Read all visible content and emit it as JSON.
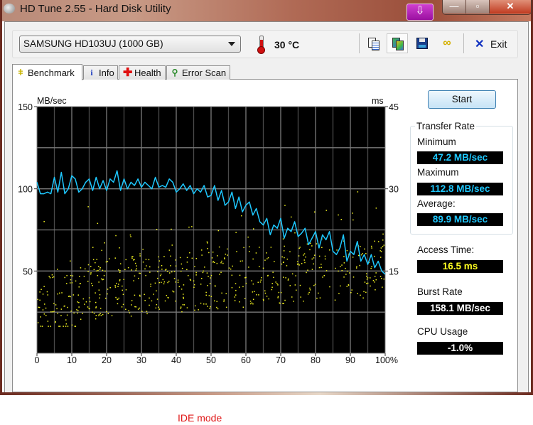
{
  "window": {
    "title": "HD Tune 2.55 - Hard Disk Utility",
    "controls": {
      "minimize": "—",
      "maximize": "▫",
      "close": "✕"
    },
    "overlay_button_icon": "down-arrow-icon"
  },
  "toolbar": {
    "drive": "SAMSUNG HD103UJ (1000 GB)",
    "temperature": "30 °C",
    "icons": [
      "copy-text-icon",
      "copy-screenshot-icon",
      "save-icon",
      "options-icon"
    ],
    "exit_label": "Exit"
  },
  "tabs": [
    {
      "label": "Benchmark",
      "icon": "bulb-icon",
      "active": true
    },
    {
      "label": "Info",
      "icon": "info-icon",
      "active": false
    },
    {
      "label": "Health",
      "icon": "health-cross-icon",
      "active": false
    },
    {
      "label": "Error Scan",
      "icon": "magnifier-icon",
      "active": false
    }
  ],
  "side_panel": {
    "start_label": "Start",
    "transfer_rate_title": "Transfer Rate",
    "minimum_label": "Minimum",
    "minimum_value": "47.2 MB/sec",
    "maximum_label": "Maximum",
    "maximum_value": "112.8 MB/sec",
    "average_label": "Average:",
    "average_value": "89.9 MB/sec",
    "access_time_label": "Access Time:",
    "access_time_value": "16.5 ms",
    "burst_rate_label": "Burst Rate",
    "burst_rate_value": "158.1 MB/sec",
    "cpu_usage_label": "CPU Usage",
    "cpu_usage_value": "-1.0%"
  },
  "footer_note": "IDE mode",
  "colors": {
    "transfer_line": "#1ec8ff",
    "access_points": "#f0f020",
    "plot_bg": "#000000",
    "grid": "#7a7a7a",
    "note": "#e01818"
  },
  "chart_data": {
    "type": "line",
    "title": "",
    "xlabel": "",
    "ylabel_left": "MB/sec",
    "ylabel_right": "ms",
    "x_ticks": [
      "0",
      "10",
      "20",
      "30",
      "40",
      "50",
      "60",
      "70",
      "80",
      "90",
      "100%"
    ],
    "y_left_ticks": [
      "50",
      "100",
      "150"
    ],
    "y_right_ticks": [
      "15",
      "30",
      "45"
    ],
    "xlim": [
      0,
      100
    ],
    "ylim_left": [
      0,
      150
    ],
    "ylim_right": [
      0,
      45
    ],
    "grid": true,
    "series": [
      {
        "name": "Transfer Rate (MB/sec)",
        "axis": "left",
        "x": [
          0,
          1,
          2,
          3,
          4,
          5,
          6,
          7,
          8,
          9,
          10,
          11,
          12,
          13,
          14,
          15,
          16,
          17,
          18,
          19,
          20,
          21,
          22,
          23,
          24,
          25,
          26,
          27,
          28,
          29,
          30,
          31,
          32,
          33,
          34,
          35,
          36,
          37,
          38,
          39,
          40,
          41,
          42,
          43,
          44,
          45,
          46,
          47,
          48,
          49,
          50,
          51,
          52,
          53,
          54,
          55,
          56,
          57,
          58,
          59,
          60,
          61,
          62,
          63,
          64,
          65,
          66,
          67,
          68,
          69,
          70,
          71,
          72,
          73,
          74,
          75,
          76,
          77,
          78,
          79,
          80,
          81,
          82,
          83,
          84,
          85,
          86,
          87,
          88,
          89,
          90,
          91,
          92,
          93,
          94,
          95,
          96,
          97,
          98,
          99,
          100
        ],
        "values": [
          104,
          97,
          97,
          98,
          97,
          107,
          98,
          110,
          97,
          100,
          108,
          106,
          98,
          100,
          104,
          106,
          99,
          107,
          100,
          105,
          99,
          106,
          104,
          111,
          99,
          106,
          100,
          104,
          102,
          106,
          101,
          104,
          102,
          100,
          107,
          101,
          102,
          101,
          106,
          104,
          98,
          100,
          103,
          99,
          102,
          97,
          100,
          98,
          102,
          95,
          96,
          102,
          93,
          99,
          90,
          92,
          98,
          88,
          95,
          86,
          90,
          92,
          84,
          88,
          80,
          78,
          82,
          72,
          78,
          76,
          82,
          70,
          76,
          74,
          80,
          71,
          73,
          76,
          66,
          70,
          74,
          64,
          72,
          69,
          74,
          62,
          60,
          64,
          72,
          56,
          62,
          60,
          68,
          56,
          60,
          54,
          60,
          52,
          56,
          50,
          48
        ]
      },
      {
        "name": "Access Time (ms)",
        "axis": "right",
        "type": "scatter",
        "note": "scattered points, mostly 7–20 ms with rising spread toward the end of the disk; average 16.5 ms"
      }
    ]
  }
}
